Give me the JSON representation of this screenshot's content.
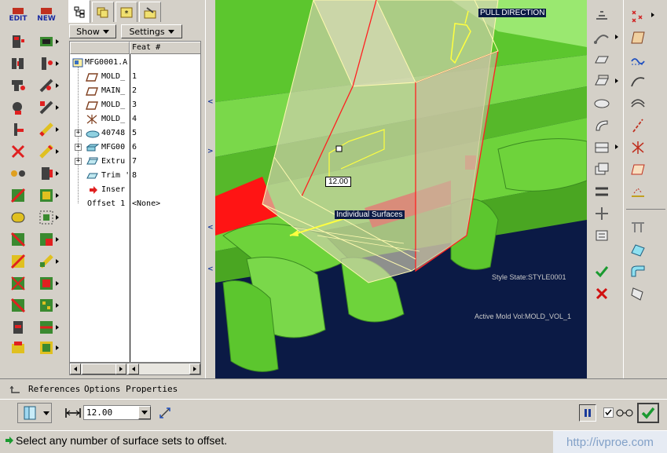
{
  "left_toolbar": {
    "edit_label": "EDIT",
    "new_label": "NEW"
  },
  "model_tree": {
    "tabs": [
      "model-tree",
      "layers",
      "favorites",
      "tools"
    ],
    "show_label": "Show",
    "settings_label": "Settings",
    "column_header": "Feat #",
    "items": [
      {
        "name": "MFG0001.A",
        "num": "",
        "expand": false,
        "icon": "assembly-icon"
      },
      {
        "name": "MOLD_",
        "num": "1",
        "expand": false,
        "icon": "datum-plane-icon"
      },
      {
        "name": "MAIN_",
        "num": "2",
        "expand": false,
        "icon": "datum-plane-icon"
      },
      {
        "name": "MOLD_",
        "num": "3",
        "expand": false,
        "icon": "datum-plane-icon"
      },
      {
        "name": "MOLD_",
        "num": "4",
        "expand": false,
        "icon": "coord-system-icon"
      },
      {
        "name": "40748",
        "num": "5",
        "expand": true,
        "icon": "part-icon"
      },
      {
        "name": "MFG00",
        "num": "6",
        "expand": true,
        "icon": "workpiece-icon"
      },
      {
        "name": "Extru",
        "num": "7",
        "expand": true,
        "icon": "extrude-icon"
      },
      {
        "name": "Trim '",
        "num": "8",
        "expand": false,
        "icon": "trim-icon"
      },
      {
        "name": "Inser",
        "num": "",
        "expand": false,
        "icon": "insert-here-icon"
      },
      {
        "name": "Offset 1",
        "num": "<None>",
        "expand": false,
        "icon": ""
      }
    ]
  },
  "viewport": {
    "pull_direction_label": "PULL DIRECTION",
    "dimension_value": "12.00",
    "surface_option_label": "Individual Surfaces",
    "style_state_label": "Style State:STYLE0001",
    "active_mold_label": "Active Mold Vol:MOLD_VOL_1",
    "colors": {
      "background": "#0b1a45",
      "mold": "#6ed33b",
      "highlight": "#ff1414",
      "volume": "#d6cfb4"
    }
  },
  "dashboard": {
    "tabs": [
      "References",
      "Options",
      "Properties"
    ],
    "offset_value": "12.00",
    "status_message": "Select any number of surface sets to offset.",
    "watermark": "http://ivproe.com"
  }
}
